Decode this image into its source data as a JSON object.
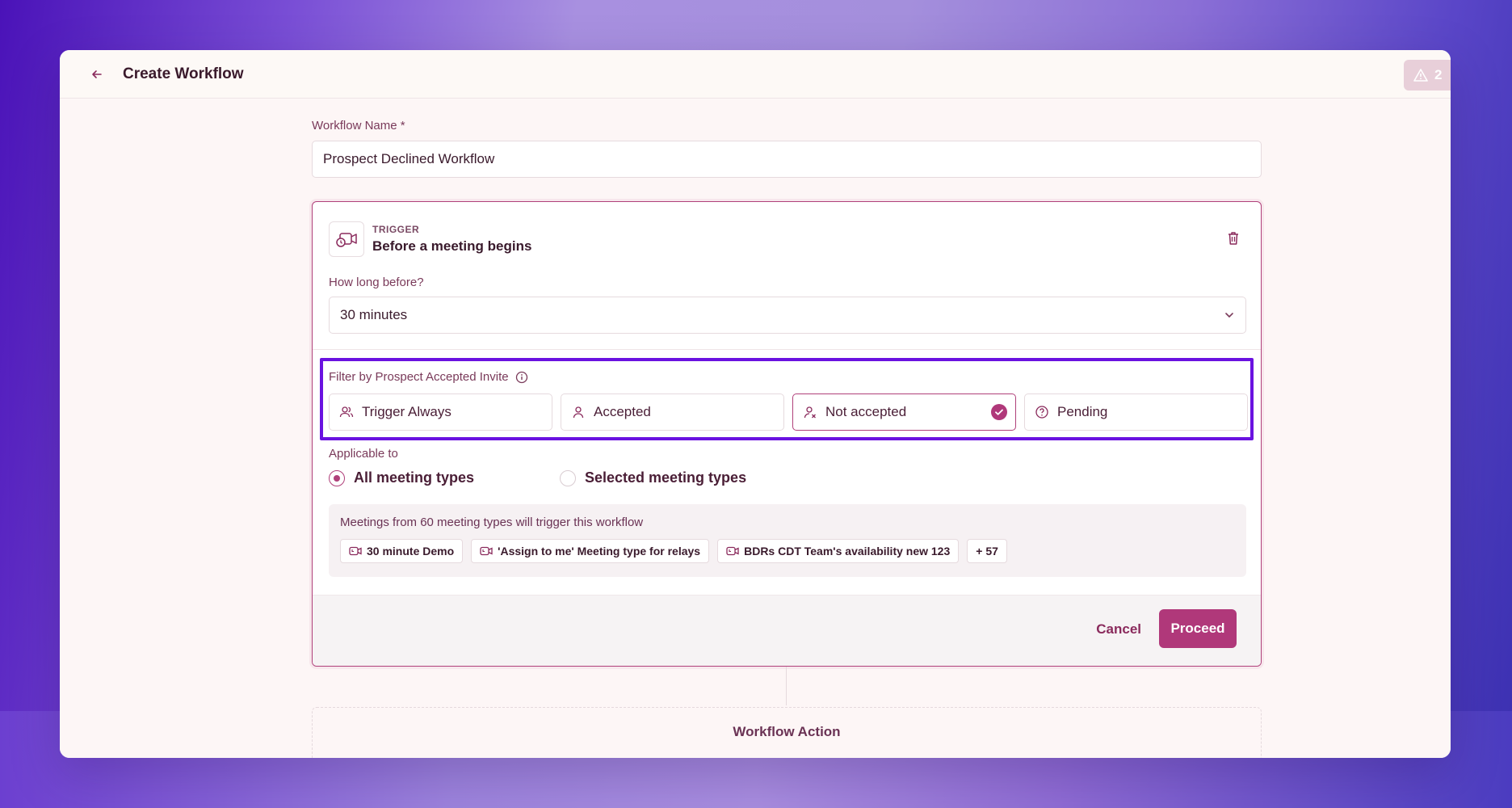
{
  "header": {
    "title": "Create Workflow",
    "alert_count": "2"
  },
  "form": {
    "name_label": "Workflow Name *",
    "name_value": "Prospect Declined Workflow"
  },
  "trigger": {
    "kicker": "TRIGGER",
    "title": "Before a meeting begins",
    "how_long_label": "How long before?",
    "how_long_value": "30 minutes"
  },
  "filter": {
    "label": "Filter by Prospect Accepted Invite",
    "options": [
      {
        "label": "Trigger Always",
        "icon": "users-icon",
        "selected": false
      },
      {
        "label": "Accepted",
        "icon": "user-icon",
        "selected": false
      },
      {
        "label": "Not accepted",
        "icon": "user-x-icon",
        "selected": true
      },
      {
        "label": "Pending",
        "icon": "question-circle-icon",
        "selected": false
      }
    ]
  },
  "applicable": {
    "label": "Applicable to",
    "options": [
      {
        "label": "All meeting types",
        "checked": true
      },
      {
        "label": "Selected meeting types",
        "checked": false
      }
    ]
  },
  "meetings": {
    "summary": "Meetings from 60 meeting types will trigger this workflow",
    "chips": [
      "30 minute Demo",
      "'Assign to me' Meeting type for relays",
      "BDRs CDT Team's availability new 123"
    ],
    "more": "+ 57"
  },
  "footer": {
    "cancel": "Cancel",
    "proceed": "Proceed"
  },
  "action": {
    "title": "Workflow Action"
  },
  "colors": {
    "accent": "#b0387a",
    "highlight": "#6a12e0"
  }
}
